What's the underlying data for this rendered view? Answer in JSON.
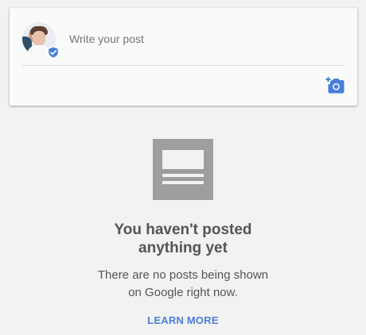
{
  "composer": {
    "placeholder": "Write your post",
    "avatar_icon": "profile-avatar",
    "verified_icon": "verified-shield-icon",
    "add_photo_icon": "add-photo-icon"
  },
  "empty_state": {
    "icon": "posts-placeholder-icon",
    "title": "You haven't posted anything yet",
    "message": "There are no posts being shown on Google right now.",
    "link_label": "LEARN MORE"
  },
  "colors": {
    "accent": "#4a7fd9",
    "icon_gray": "#9e9e9e",
    "background": "#f2f2f2"
  }
}
